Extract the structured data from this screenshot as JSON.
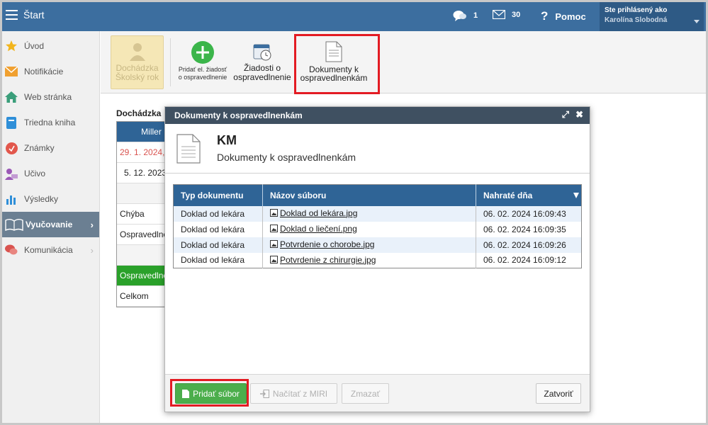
{
  "topbar": {
    "title": "Štart",
    "messages_count": "1",
    "mail_count": "30",
    "help_label": "Pomoc",
    "user_label": "Ste prihlásený ako",
    "user_name": "Karolína Slobodná"
  },
  "sidebar": {
    "items": [
      {
        "label": "Úvod",
        "icon": "star-icon"
      },
      {
        "label": "Notifikácie",
        "icon": "envelope-icon"
      },
      {
        "label": "Web stránka",
        "icon": "home-icon"
      },
      {
        "label": "Triedna kniha",
        "icon": "book-icon"
      },
      {
        "label": "Známky",
        "icon": "grade-icon"
      },
      {
        "label": "Učivo",
        "icon": "teacher-icon"
      },
      {
        "label": "Výsledky",
        "icon": "bar-chart-icon"
      },
      {
        "label": "Vyučovanie",
        "icon": "open-book-icon",
        "active": true
      },
      {
        "label": "Komunikácia",
        "icon": "chat-icon"
      }
    ]
  },
  "toolbar": {
    "attendance_label": "Dochádzka Školský rok",
    "add_excuse_label": "Pridať el. žiadosť o ospravedlnenie",
    "requests_label": "Žiadosti o ospravedlnenie",
    "documents_label": "Dokumenty k ospravedlnenkám"
  },
  "background": {
    "section_title": "Dochádzka",
    "header_name": "Miller",
    "date1": "29. 1. 2024,",
    "date2": "5. 12. 2023",
    "row_absence": "Chýba",
    "row_excused": "Ospravedlnené",
    "row_excused_green": "Ospravedlnené",
    "row_total": "Celkom"
  },
  "modal": {
    "header": "Dokumenty k ospravedlnenkám",
    "title": "KM",
    "subtitle": "Dokumenty k ospravedlnenkám",
    "columns": [
      "Typ dokumentu",
      "Názov súboru",
      "Nahraté dňa"
    ],
    "rows": [
      {
        "type": "Doklad od lekára",
        "file": "Doklad od lekára.jpg",
        "date": "06. 02. 2024 16:09:43"
      },
      {
        "type": "Doklad od lekára",
        "file": "Doklad o liečení.png",
        "date": "06. 02. 2024 16:09:35"
      },
      {
        "type": "Doklad od lekára",
        "file": "Potvrdenie o chorobe.jpg",
        "date": "06. 02. 2024 16:09:26"
      },
      {
        "type": "Doklad od lekára",
        "file": "Potvrdenie z chirurgie.jpg",
        "date": "06. 02. 2024 16:09:12"
      }
    ],
    "btn_add": "Pridať súbor",
    "btn_load": "Načítať z MIRI",
    "btn_delete": "Zmazať",
    "btn_close": "Zatvoriť"
  },
  "colors": {
    "topbar": "#3c6e9f",
    "modal_header": "#3f5061",
    "grid_header": "#2f6496",
    "highlight": "#e31b23",
    "add_button": "#4cae4c"
  }
}
